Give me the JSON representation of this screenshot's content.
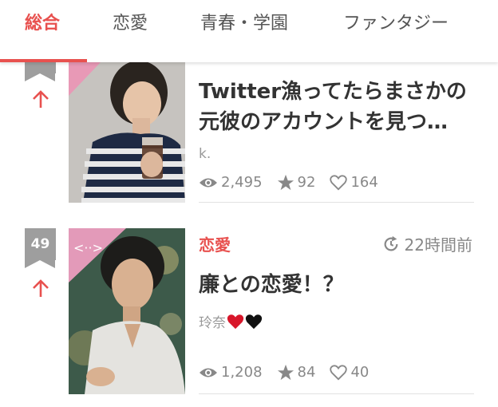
{
  "tabs": [
    {
      "label": "総合",
      "active": true
    },
    {
      "label": "恋愛",
      "active": false
    },
    {
      "label": "青春・学園",
      "active": false
    },
    {
      "label": "ファンタジー",
      "active": false
    }
  ],
  "colors": {
    "accent": "#e8514f",
    "badge": "#9e9e9e",
    "muted": "#888888"
  },
  "entries": [
    {
      "rank": "",
      "trend": "up",
      "title_line1": "Twitter漁ってたらまさかの",
      "title_line2": "元彼のアカウントを見つ…",
      "author": "k.",
      "views": "2,495",
      "stars": "92",
      "likes": "164"
    },
    {
      "rank": "49",
      "trend": "up",
      "genre": "恋愛",
      "updated": "22時間前",
      "title_line1": "廉との恋愛！？",
      "author": "玲奈",
      "author_emoji": [
        "red-heart-icon",
        "black-heart-icon"
      ],
      "views": "1,208",
      "stars": "84",
      "likes": "40"
    }
  ]
}
